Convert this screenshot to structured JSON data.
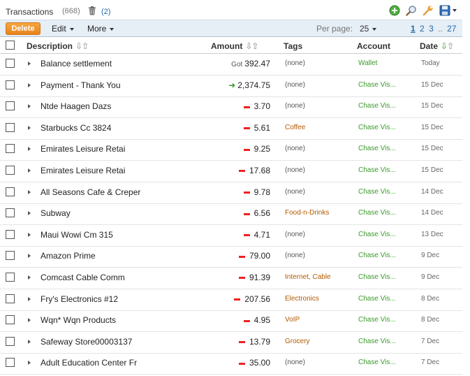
{
  "header": {
    "title": "Transactions",
    "count": "(668)",
    "trash_count": "(2)"
  },
  "toolbar": {
    "delete_label": "Delete",
    "edit_label": "Edit",
    "more_label": "More",
    "per_page_label": "Per page:",
    "per_page_value": "25",
    "pages": [
      "1",
      "2",
      "3",
      "..",
      "27"
    ],
    "current_page": "1"
  },
  "columns": {
    "description": "Description",
    "amount": "Amount",
    "tags": "Tags",
    "account": "Account",
    "date": "Date"
  },
  "icons": {
    "add": "add-icon",
    "search": "magnifier-icon",
    "settings": "wrench-icon",
    "save": "save-icon",
    "trash": "trash-icon"
  },
  "colors": {
    "delete_button": "#e7841b",
    "toolbar_bg": "#e6eef6",
    "negative": "#e22222",
    "positive": "#3a9a2a",
    "tag": "#b35a00",
    "account": "#3a9a2a",
    "link": "#2266aa"
  },
  "rows": [
    {
      "desc": "Balance settlement",
      "prefix": "Got",
      "sign": "none",
      "amount": "392.47",
      "tag": "(none)",
      "account": "Wallet",
      "date": "Today"
    },
    {
      "desc": "Payment - Thank You",
      "prefix": "",
      "sign": "in",
      "amount": "2,374.75",
      "tag": "(none)",
      "account": "Chase Vis...",
      "date": "15 Dec"
    },
    {
      "desc": "Ntde Haagen Dazs",
      "prefix": "",
      "sign": "out",
      "amount": "3.70",
      "tag": "(none)",
      "account": "Chase Vis...",
      "date": "15 Dec"
    },
    {
      "desc": "Starbucks Cc 3824",
      "prefix": "",
      "sign": "out",
      "amount": "5.61",
      "tag": "Coffee",
      "account": "Chase Vis...",
      "date": "15 Dec"
    },
    {
      "desc": "Emirates Leisure Retai",
      "prefix": "",
      "sign": "out",
      "amount": "9.25",
      "tag": "(none)",
      "account": "Chase Vis...",
      "date": "15 Dec"
    },
    {
      "desc": "Emirates Leisure Retai",
      "prefix": "",
      "sign": "out",
      "amount": "17.68",
      "tag": "(none)",
      "account": "Chase Vis...",
      "date": "15 Dec"
    },
    {
      "desc": "All Seasons Cafe & Creper",
      "prefix": "",
      "sign": "out",
      "amount": "9.78",
      "tag": "(none)",
      "account": "Chase Vis...",
      "date": "14 Dec"
    },
    {
      "desc": "Subway",
      "prefix": "",
      "sign": "out",
      "amount": "6.56",
      "tag": "Food-n-Drinks",
      "account": "Chase Vis...",
      "date": "14 Dec"
    },
    {
      "desc": "Maui Wowi Cm 315",
      "prefix": "",
      "sign": "out",
      "amount": "4.71",
      "tag": "(none)",
      "account": "Chase Vis...",
      "date": "13 Dec"
    },
    {
      "desc": "Amazon Prime",
      "prefix": "",
      "sign": "out",
      "amount": "79.00",
      "tag": "(none)",
      "account": "Chase Vis...",
      "date": "9 Dec"
    },
    {
      "desc": "Comcast Cable Comm",
      "prefix": "",
      "sign": "out",
      "amount": "91.39",
      "tag": "Internet, Cable",
      "account": "Chase Vis...",
      "date": "9 Dec"
    },
    {
      "desc": "Fry's Electronics #12",
      "prefix": "",
      "sign": "out",
      "amount": "207.56",
      "tag": "Electronics",
      "account": "Chase Vis...",
      "date": "8 Dec"
    },
    {
      "desc": "Wqn* Wqn Products",
      "prefix": "",
      "sign": "out",
      "amount": "4.95",
      "tag": "VoIP",
      "account": "Chase Vis...",
      "date": "8 Dec"
    },
    {
      "desc": "Safeway Store00003137",
      "prefix": "",
      "sign": "out",
      "amount": "13.79",
      "tag": "Grocery",
      "account": "Chase Vis...",
      "date": "7 Dec"
    },
    {
      "desc": "Adult Education Center Fr",
      "prefix": "",
      "sign": "out",
      "amount": "35.00",
      "tag": "(none)",
      "account": "Chase Vis...",
      "date": "7 Dec"
    }
  ]
}
